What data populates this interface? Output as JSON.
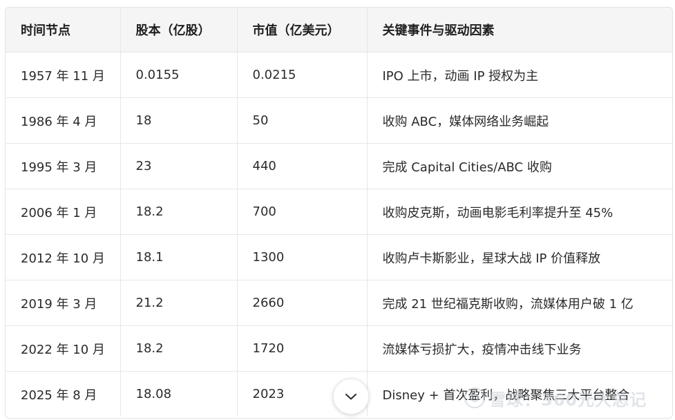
{
  "table": {
    "headers": [
      "时间节点",
      "股本（亿股）",
      "市值（亿美元）",
      "关键事件与驱动因素"
    ],
    "rows": [
      [
        "1957 年 11 月",
        "0.0155",
        "0.0215",
        "IPO 上市，动画 IP 授权为主"
      ],
      [
        "1986 年 4 月",
        "18",
        "50",
        "收购 ABC，媒体网络业务崛起"
      ],
      [
        "1995 年 3 月",
        "23",
        "440",
        "完成 Capital Cities/ABC 收购"
      ],
      [
        "2006 年 1 月",
        "18.2",
        "700",
        "收购皮克斯，动画电影毛利率提升至 45%"
      ],
      [
        "2012 年 10 月",
        "18.1",
        "1300",
        "收购卢卡斯影业，星球大战 IP 价值释放"
      ],
      [
        "2019 年 3 月",
        "21.2",
        "2660",
        "完成 21 世纪福克斯收购，流媒体用户破 1 亿"
      ],
      [
        "2022 年 10 月",
        "18.2",
        "1720",
        "流媒体亏损扩大，疫情冲击线下业务"
      ],
      [
        "2025 年 8 月",
        "18.08",
        "2023",
        "Disney + 首次盈利，战略聚焦三大平台整合"
      ]
    ]
  },
  "watermark": {
    "text": "雪球：360元大总记"
  },
  "icons": {
    "expand": "chevron-down-icon",
    "watermark_logo": "snowball-logo-icon"
  }
}
